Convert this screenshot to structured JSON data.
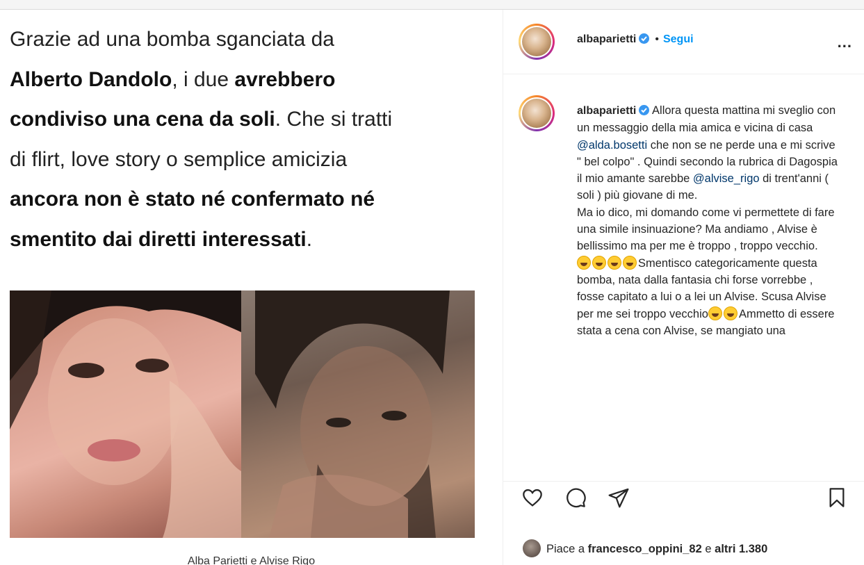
{
  "article": {
    "l1": "Grazie ad una bomba sganciata da",
    "l2_bold": "Alberto Dandolo",
    "l2_rest": ", i due ",
    "l2_bold2": "avrebbero",
    "l3_bold": "condiviso una cena da soli",
    "l3_rest": ". Che si tratti",
    "l4": "di flirt, love story o semplice amicizia",
    "l5_bold": "ancora non è stato né confermato né",
    "l6_bold": "smentito dai diretti interessati",
    "l6_rest": ".",
    "caption": "Alba Parietti e Alvise Rigo"
  },
  "header": {
    "username": "albaparietti",
    "separator": "•",
    "follow": "Segui",
    "more": "..."
  },
  "post_caption": {
    "username": "albaparietti",
    "p1": " Allora questa mattina mi sveglio con un messaggio della mia amica e vicina di casa ",
    "mention1": "@alda.bosetti",
    "p2": " che non se ne perde una e mi scrive \" bel colpo\" . Quindi secondo la rubrica di Dagospia il mio amante sarebbe ",
    "mention2": "@alvise_rigo",
    "p3": " di trent'anni ( soli ) più giovane di me.",
    "p4": "Ma io dico, mi domando come vi permettete di fare una simile insinuazione? Ma andiamo , Alvise è bellissimo ma per me è troppo , troppo vecchio.",
    "p5": "Smentisco categoricamente questa bomba, nata dalla fantasia chi forse vorrebbe , fosse capitato a lui o a lei un Alvise. Scusa Alvise per me sei troppo vecchio",
    "p6": "Ammetto di essere stata a cena con Alvise, se mangiato una"
  },
  "likes": {
    "prefix": "Piace a ",
    "user": "francesco_oppini_82",
    "middle": " e ",
    "others": "altri 1.380"
  },
  "icons": [
    "heart-icon",
    "comment-icon",
    "share-icon",
    "bookmark-icon",
    "verified-icon",
    "emoji-laughing-icon"
  ],
  "colors": {
    "link": "#0095f6",
    "mention": "#00376b",
    "verified": "#3897f0",
    "text": "#262626"
  }
}
